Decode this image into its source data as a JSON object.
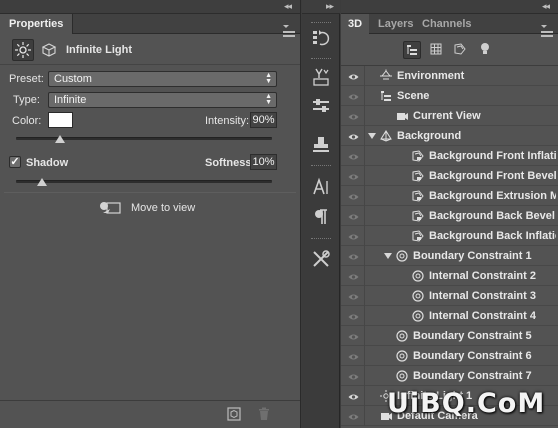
{
  "properties": {
    "strip_collapse": "◂◂",
    "tab_label": "Properties",
    "light_name": "Infinite Light",
    "preset_label": "Preset:",
    "preset_value": "Custom",
    "type_label": "Type:",
    "type_value": "Infinite",
    "color_label": "Color:",
    "intensity_label": "Intensity:",
    "intensity_value": "90%",
    "intensity_fraction": 0.17,
    "shadow_label": "Shadow",
    "shadow_checked": "✓",
    "softness_label": "Softness:",
    "softness_value": "10%",
    "softness_fraction": 0.1,
    "move_to_view_label": "Move to view"
  },
  "tools_strip": {
    "collapse": "▸▸"
  },
  "panel3d": {
    "strip_collapse": "◂◂",
    "tabs": [
      {
        "label": "3D"
      },
      {
        "label": "Layers"
      },
      {
        "label": "Channels"
      }
    ],
    "rows": [
      {
        "label": "Environment",
        "icon": "environment-icon"
      },
      {
        "label": "Scene",
        "icon": "scene-icon"
      },
      {
        "label": "Current View",
        "icon": "camera-icon"
      },
      {
        "label": "Background",
        "icon": "mesh-icon"
      },
      {
        "label": "Background Front Inflatio...",
        "icon": "material-icon"
      },
      {
        "label": "Background Front Bevel M...",
        "icon": "material-icon"
      },
      {
        "label": "Background Extrusion Ma...",
        "icon": "material-icon"
      },
      {
        "label": "Background Back Bevel M...",
        "icon": "material-icon"
      },
      {
        "label": "Background Back Inflation...",
        "icon": "material-icon"
      },
      {
        "label": "Boundary Constraint 1",
        "icon": "constraint-icon"
      },
      {
        "label": "Internal Constraint 2",
        "icon": "constraint-icon"
      },
      {
        "label": "Internal Constraint 3",
        "icon": "constraint-icon"
      },
      {
        "label": "Internal Constraint 4",
        "icon": "constraint-icon"
      },
      {
        "label": "Boundary Constraint 5",
        "icon": "constraint-icon"
      },
      {
        "label": "Boundary Constraint 6",
        "icon": "constraint-icon"
      },
      {
        "label": "Boundary Constraint 7",
        "icon": "constraint-icon"
      },
      {
        "label": "Infinite Light 1",
        "icon": "light-icon"
      },
      {
        "label": "Default Camera",
        "icon": "camera-icon"
      }
    ]
  },
  "watermark": "UiBQ.CoM"
}
